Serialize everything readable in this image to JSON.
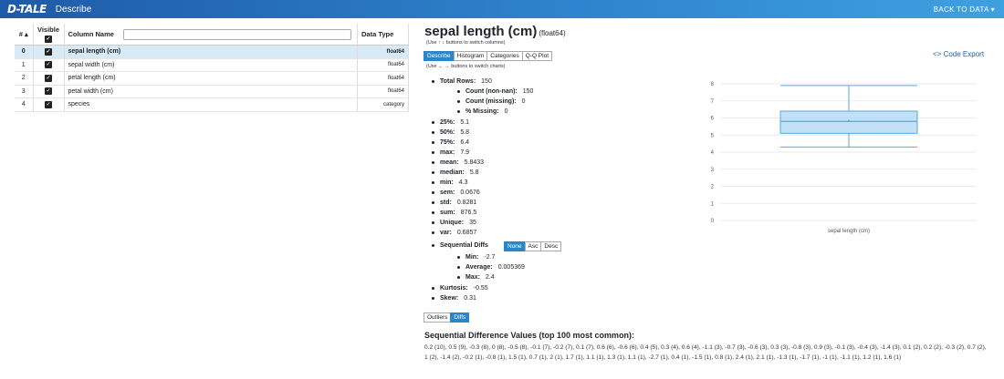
{
  "header": {
    "logo": "D-TALE",
    "title": "Describe",
    "back_label": "BACK TO DATA ▾"
  },
  "columns_table": {
    "headers": {
      "index": "# ▴",
      "visible": "Visible",
      "name": "Column Name",
      "type": "Data Type"
    },
    "rows": [
      {
        "idx": "0",
        "name": "sepal length (cm)",
        "type": "float64"
      },
      {
        "idx": "1",
        "name": "sepal width (cm)",
        "type": "float64"
      },
      {
        "idx": "2",
        "name": "petal length (cm)",
        "type": "float64"
      },
      {
        "idx": "3",
        "name": "petal width (cm)",
        "type": "float64"
      },
      {
        "idx": "4",
        "name": "species",
        "type": "category"
      }
    ]
  },
  "detail": {
    "title": "sepal length (cm)",
    "dtype": "(float64)",
    "hint_columns": "(Use ↑ ↓ buttons to switch columns)",
    "hint_charts": "(Use ← → buttons to switch charts)",
    "tabs": [
      "Describe",
      "Histogram",
      "Categories",
      "Q-Q Plot"
    ],
    "code_export": "<> Code Export",
    "stats": {
      "total_rows": {
        "label": "Total Rows:",
        "value": "150"
      },
      "count_nonnan": {
        "label": "Count (non-nan):",
        "value": "150"
      },
      "count_missing": {
        "label": "Count (missing):",
        "value": "0"
      },
      "pct_missing": {
        "label": "% Missing:",
        "value": "0"
      },
      "p25": {
        "label": "25%:",
        "value": "5.1"
      },
      "p50": {
        "label": "50%:",
        "value": "5.8"
      },
      "p75": {
        "label": "75%:",
        "value": "6.4"
      },
      "max": {
        "label": "max:",
        "value": "7.9"
      },
      "mean": {
        "label": "mean:",
        "value": "5.8433"
      },
      "median": {
        "label": "median:",
        "value": "5.8"
      },
      "min": {
        "label": "min:",
        "value": "4.3"
      },
      "sem": {
        "label": "sem:",
        "value": "0.0676"
      },
      "std": {
        "label": "std:",
        "value": "0.8281"
      },
      "sum": {
        "label": "sum:",
        "value": "876.5"
      },
      "unique": {
        "label": "Unique:",
        "value": "35"
      },
      "var": {
        "label": "var:",
        "value": "0.6857"
      },
      "seq_diffs": {
        "label": "Sequential Diffs"
      },
      "seq_min": {
        "label": "Min:",
        "value": "-2.7"
      },
      "seq_avg": {
        "label": "Average:",
        "value": "0.005369"
      },
      "seq_max": {
        "label": "Max:",
        "value": "2.4"
      },
      "kurtosis": {
        "label": "Kurtosis:",
        "value": "-0.55"
      },
      "skew": {
        "label": "Skew:",
        "value": "0.31"
      }
    },
    "diff_buttons": [
      "None",
      "Asc",
      "Desc"
    ],
    "bottom_tabs": [
      "Outliers",
      "Diffs"
    ],
    "seq_title": "Sequential Difference Values (top 100 most common):",
    "seq_values": "0.2 (10), 0.5 (9), -0.3 (8), 0 (8), -0.5 (8), -0.1 (7), -0.2 (7), 0.1 (7), 0.6 (6), -0.6 (6), 0.4 (5), 0.3 (4), 0.6 (4), -1.1 (3), -0.7 (3), -0.6 (3), 0.3 (3), -0.8 (3), 0.9 (3), -0.1 (3), -0.4 (3), -1.4 (3), 0.1 (2), 0.2 (2), -0.3 (2), 0.7 (2), 1 (2), -1.4 (2), -0.2 (1), -0.8 (1), 1.5 (1), 0.7 (1), 2 (1), 1.7 (1), 1.1 (1), 1.3 (1), 1.1 (1), -2.7 (1), 0.4 (1), -1.5 (1), 0.8 (1), 2.4 (1), 2.1 (1), -1.3 (1), -1.7 (1), -1 (1), -1.1 (1), 1.2 (1), 1.6 (1)"
  },
  "colors": {
    "accent": "#2a86c9",
    "box_fill": "#a9d4f2",
    "box_stroke": "#56a7dc",
    "selected_row": "#d8eaf6"
  },
  "chart_data": {
    "type": "box",
    "categories": [
      "sepal length (cm)"
    ],
    "min": 4.3,
    "q1": 5.1,
    "median": 5.8,
    "q3": 6.4,
    "max": 7.9,
    "mean": 5.8433,
    "ylim": [
      0,
      8
    ],
    "yticks": [
      0,
      1,
      2,
      3,
      4,
      5,
      6,
      7,
      8
    ],
    "grid": true
  }
}
